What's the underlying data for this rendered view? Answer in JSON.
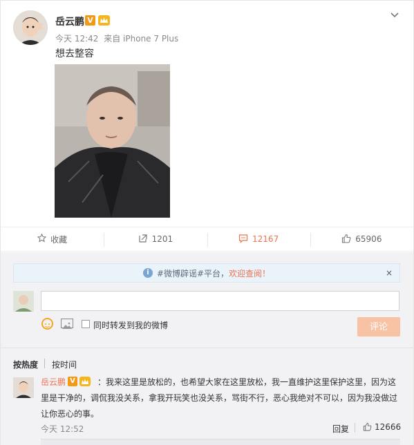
{
  "post": {
    "author": "岳云鹏",
    "verified_badge": "V",
    "time": "今天 12:42",
    "source": "来自 iPhone 7 Plus",
    "text": "想去整容"
  },
  "actions": [
    {
      "icon": "star-icon",
      "label": "收藏"
    },
    {
      "icon": "share-icon",
      "label": "1201"
    },
    {
      "icon": "comment-icon",
      "label": "12167"
    },
    {
      "icon": "thumbs-up-icon",
      "label": "65906"
    }
  ],
  "notice": {
    "prefix": "#微博辟谣#平台，",
    "link": "欢迎查阅！",
    "close": "×"
  },
  "composer": {
    "placeholder": "",
    "forward_label": "同时转发到我的微博",
    "submit_label": "评论"
  },
  "sort": {
    "hot": "按热度",
    "time": "按时间"
  },
  "comment": {
    "author": "岳云鹏",
    "verified_badge": "V",
    "text": "：我来这里是放松的，也希望大家在这里放松，我一直维护这里保护这里，因为这里是干净的，调侃我没关系，拿我开玩笑也没关系，骂街不行，恶心我绝对不可以，因为我没做过让你恶心的事。",
    "time": "今天 12:52",
    "reply_label": "回复",
    "like_count": "12666"
  },
  "colors": {
    "accent": "#eb7350",
    "panel_bg": "#f2f2f5",
    "badge_orange": "#f29a15"
  }
}
